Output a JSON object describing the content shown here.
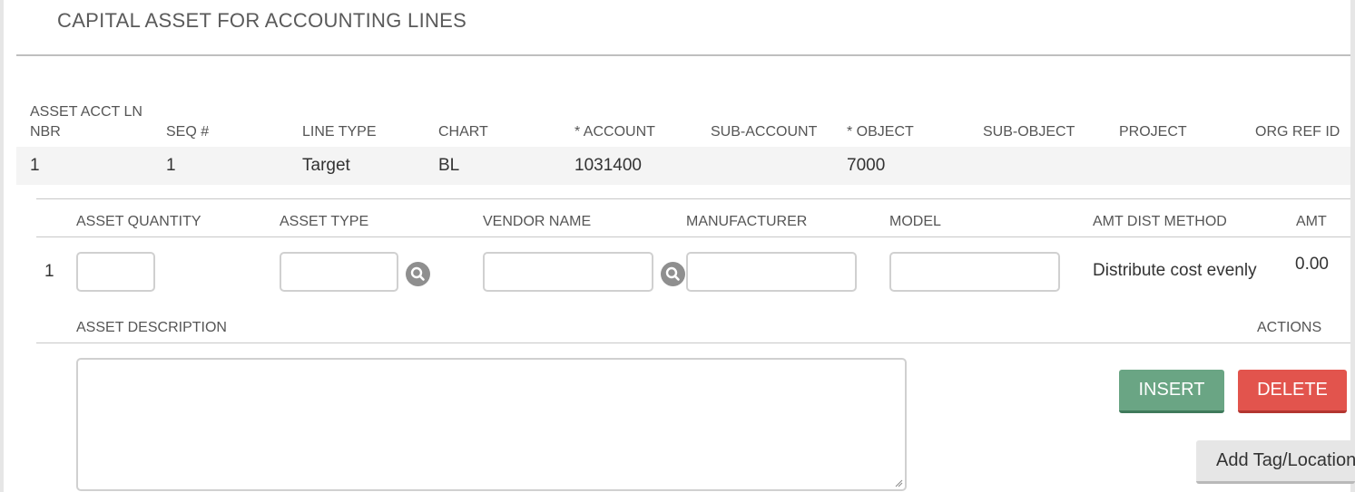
{
  "section": {
    "title": "CAPITAL ASSET FOR ACCOUNTING LINES"
  },
  "accounting_lines": {
    "headers": {
      "asset_acct_ln_nbr_line1": "ASSET ACCT LN",
      "asset_acct_ln_nbr_line2": "NBR",
      "seq": "SEQ #",
      "line_type": "LINE TYPE",
      "chart": "CHART",
      "account": "* ACCOUNT",
      "sub_account": "SUB-ACCOUNT",
      "object": "* OBJECT",
      "sub_object": "SUB-OBJECT",
      "project": "PROJECT",
      "org_ref_id": "ORG REF ID"
    },
    "row": {
      "asset_acct_ln_nbr": "1",
      "seq": "1",
      "line_type": "Target",
      "chart": "BL",
      "account": "1031400",
      "sub_account": "",
      "object": "7000",
      "sub_object": "",
      "project": "",
      "org_ref_id": ""
    }
  },
  "asset_detail": {
    "headers": {
      "asset_quantity": "ASSET QUANTITY",
      "asset_type": "ASSET TYPE",
      "vendor_name": "VENDOR NAME",
      "manufacturer": "MANUFACTURER",
      "model": "MODEL",
      "amt_dist_method": "AMT DIST METHOD",
      "amt": "AMT",
      "asset_description": "ASSET DESCRIPTION",
      "actions": "ACTIONS"
    },
    "row": {
      "number": "1",
      "asset_quantity": "",
      "asset_type": "",
      "vendor_name": "",
      "manufacturer": "",
      "model": "",
      "amt_dist_method": "Distribute cost evenly",
      "amt": "0.00",
      "asset_description": ""
    },
    "icons": {
      "asset_type_lookup": "search-icon",
      "vendor_name_lookup": "search-icon"
    }
  },
  "actions": {
    "insert_label": "INSERT",
    "delete_label": "DELETE",
    "add_tag_location_label": "Add Tag/Location"
  },
  "colors": {
    "insert": "#6aa584",
    "delete": "#e2544d",
    "secondary_button": "#e6e6e6"
  }
}
